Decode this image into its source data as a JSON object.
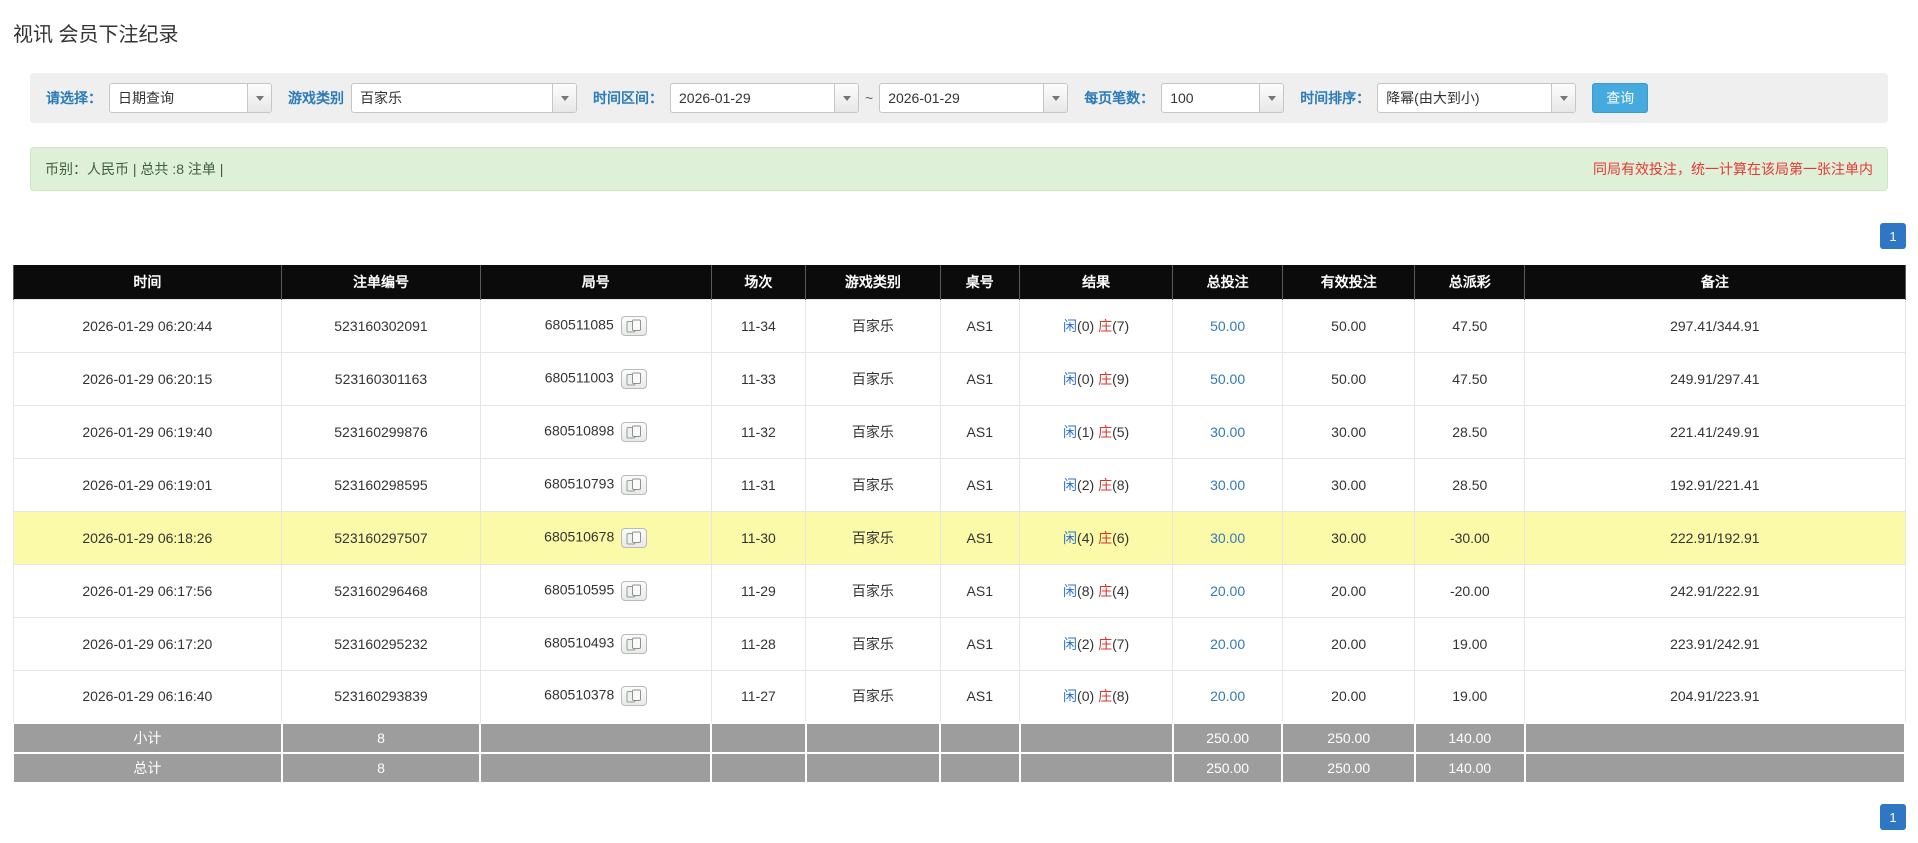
{
  "page": {
    "title": "视讯 会员下注纪录"
  },
  "filters": {
    "select_label": "请选择：",
    "select_value": "日期查询",
    "game_label": "游戏类别",
    "game_value": "百家乐",
    "range_label": "时间区间：",
    "date_from": "2026-01-29",
    "range_separator": "~",
    "date_to": "2026-01-29",
    "per_page_label": "每页笔数：",
    "per_page_value": "100",
    "sort_label": "时间排序：",
    "sort_value": "降幂(由大到小)",
    "search_button": "查询"
  },
  "summary": {
    "left": "币别：人民币 | 总共 :8 注单 |",
    "right": "同局有效投注，统一计算在该局第一张注单内"
  },
  "pagination": {
    "page": "1"
  },
  "colors": {
    "player_blue": "#2a6fd1",
    "banker_red": "#d9342b",
    "negative_red": "#e53935",
    "highlight_yellow": "#fafaa8",
    "link_blue": "#337ab7",
    "search_button_blue": "#45aadd",
    "pager_blue": "#2f76c4",
    "header_black": "#0b0b0b",
    "footer_gray": "#9d9d9d",
    "summary_green": "#dff0d8"
  },
  "table": {
    "headers": [
      "时间",
      "注单编号",
      "局号",
      "场次",
      "游戏类别",
      "桌号",
      "结果",
      "总投注",
      "有效投注",
      "总派彩",
      "备注"
    ],
    "rows": [
      {
        "time": "2026-01-29 06:20:44",
        "bet_id": "523160302091",
        "round": "680511085",
        "session": "11-34",
        "game": "百家乐",
        "table_no": "AS1",
        "player": "闲",
        "player_score": "(0)",
        "banker": "庄",
        "banker_score": "(7)",
        "total_bet": "50.00",
        "valid_bet": "50.00",
        "payout": "47.50",
        "remark": "297.41/344.91",
        "highlight": false
      },
      {
        "time": "2026-01-29 06:20:15",
        "bet_id": "523160301163",
        "round": "680511003",
        "session": "11-33",
        "game": "百家乐",
        "table_no": "AS1",
        "player": "闲",
        "player_score": "(0)",
        "banker": "庄",
        "banker_score": "(9)",
        "total_bet": "50.00",
        "valid_bet": "50.00",
        "payout": "47.50",
        "remark": "249.91/297.41",
        "highlight": false
      },
      {
        "time": "2026-01-29 06:19:40",
        "bet_id": "523160299876",
        "round": "680510898",
        "session": "11-32",
        "game": "百家乐",
        "table_no": "AS1",
        "player": "闲",
        "player_score": "(1)",
        "banker": "庄",
        "banker_score": "(5)",
        "total_bet": "30.00",
        "valid_bet": "30.00",
        "payout": "28.50",
        "remark": "221.41/249.91",
        "highlight": false
      },
      {
        "time": "2026-01-29 06:19:01",
        "bet_id": "523160298595",
        "round": "680510793",
        "session": "11-31",
        "game": "百家乐",
        "table_no": "AS1",
        "player": "闲",
        "player_score": "(2)",
        "banker": "庄",
        "banker_score": "(8)",
        "total_bet": "30.00",
        "valid_bet": "30.00",
        "payout": "28.50",
        "remark": "192.91/221.41",
        "highlight": false
      },
      {
        "time": "2026-01-29 06:18:26",
        "bet_id": "523160297507",
        "round": "680510678",
        "session": "11-30",
        "game": "百家乐",
        "table_no": "AS1",
        "player": "闲",
        "player_score": "(4)",
        "banker": "庄",
        "banker_score": "(6)",
        "total_bet": "30.00",
        "valid_bet": "30.00",
        "payout": "-30.00",
        "remark": "222.91/192.91",
        "highlight": true
      },
      {
        "time": "2026-01-29 06:17:56",
        "bet_id": "523160296468",
        "round": "680510595",
        "session": "11-29",
        "game": "百家乐",
        "table_no": "AS1",
        "player": "闲",
        "player_score": "(8)",
        "banker": "庄",
        "banker_score": "(4)",
        "total_bet": "20.00",
        "valid_bet": "20.00",
        "payout": "-20.00",
        "remark": "242.91/222.91",
        "highlight": false
      },
      {
        "time": "2026-01-29 06:17:20",
        "bet_id": "523160295232",
        "round": "680510493",
        "session": "11-28",
        "game": "百家乐",
        "table_no": "AS1",
        "player": "闲",
        "player_score": "(2)",
        "banker": "庄",
        "banker_score": "(7)",
        "total_bet": "20.00",
        "valid_bet": "20.00",
        "payout": "19.00",
        "remark": "223.91/242.91",
        "highlight": false
      },
      {
        "time": "2026-01-29 06:16:40",
        "bet_id": "523160293839",
        "round": "680510378",
        "session": "11-27",
        "game": "百家乐",
        "table_no": "AS1",
        "player": "闲",
        "player_score": "(0)",
        "banker": "庄",
        "banker_score": "(8)",
        "total_bet": "20.00",
        "valid_bet": "20.00",
        "payout": "19.00",
        "remark": "204.91/223.91",
        "highlight": false
      }
    ],
    "subtotal": {
      "label": "小计",
      "count": "8",
      "total_bet": "250.00",
      "valid_bet": "250.00",
      "payout": "140.00"
    },
    "total": {
      "label": "总计",
      "count": "8",
      "total_bet": "250.00",
      "valid_bet": "250.00",
      "payout": "140.00"
    }
  }
}
